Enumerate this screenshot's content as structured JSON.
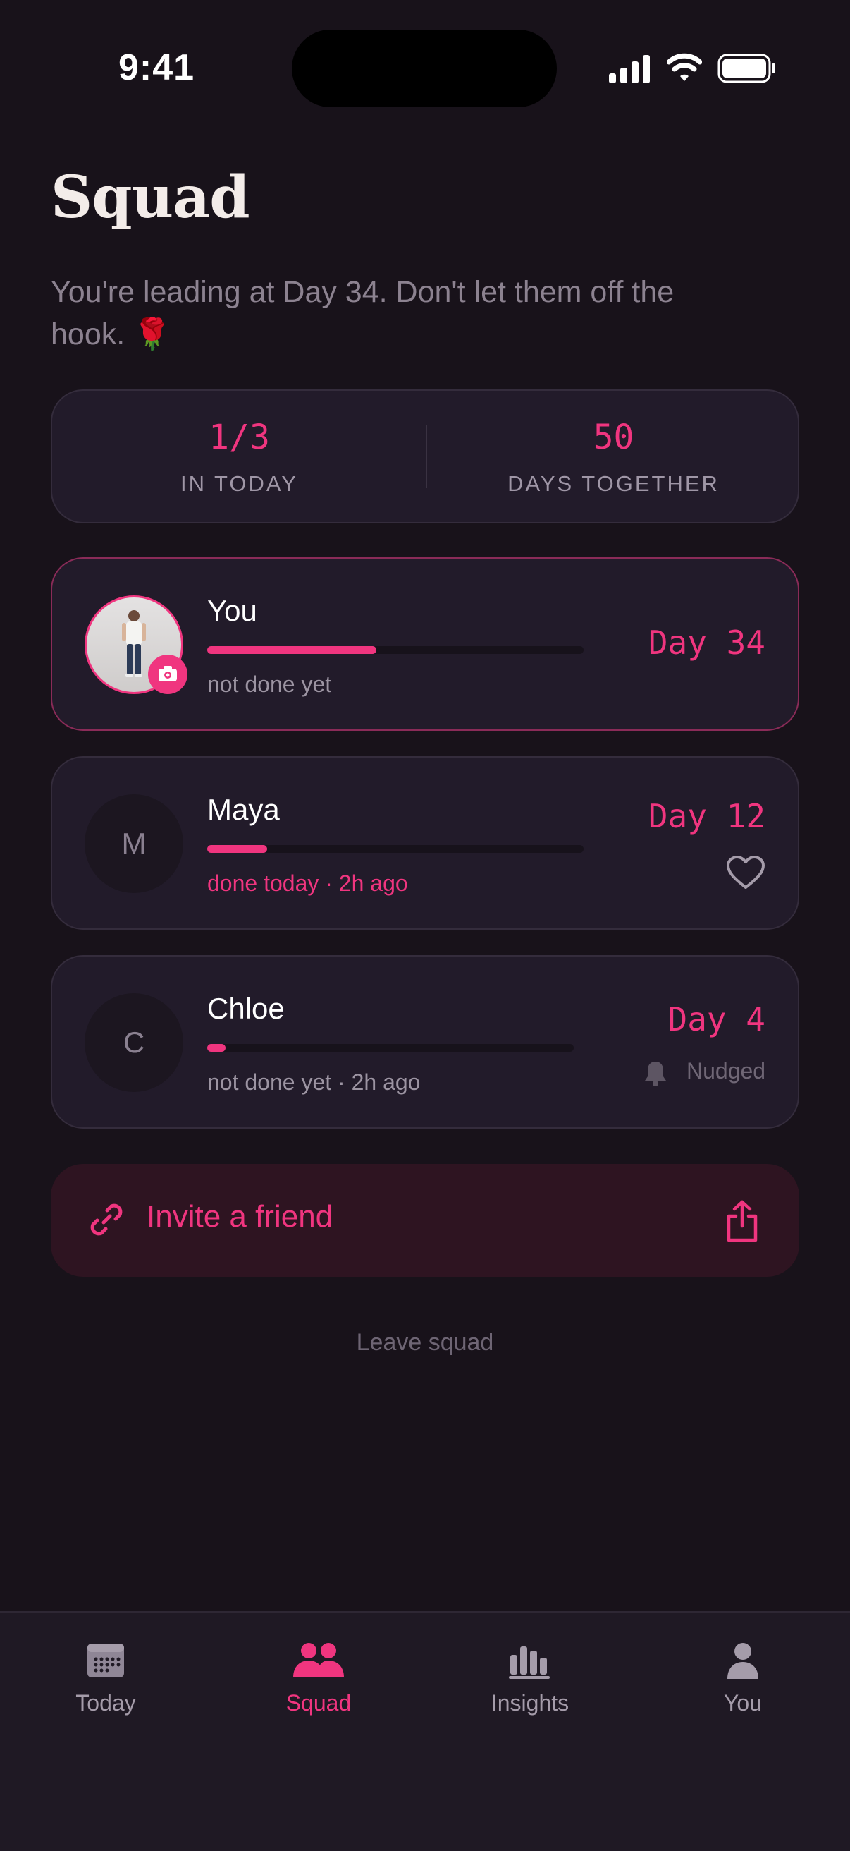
{
  "status_bar": {
    "time": "9:41"
  },
  "header": {
    "title": "Squad",
    "subtitle": "You're leading at Day 34. Don't let them off the hook. 🌹"
  },
  "stats": [
    {
      "value": "1/3",
      "label": "IN TODAY"
    },
    {
      "value": "50",
      "label": "DAYS TOGETHER"
    }
  ],
  "members": [
    {
      "name": "You",
      "initial": "",
      "status": "not done yet",
      "day": "Day 34",
      "progress": 0.45
    },
    {
      "name": "Maya",
      "initial": "M",
      "status": "done today · 2h ago",
      "day": "Day 12",
      "progress": 0.16,
      "action_icon": "heart-icon"
    },
    {
      "name": "Chloe",
      "initial": "C",
      "status": "not done yet · 2h ago",
      "day": "Day 4",
      "progress": 0.05,
      "action_label": "Nudged",
      "action_icon": "bell-icon"
    }
  ],
  "invite": {
    "label": "Invite a friend"
  },
  "leave": {
    "label": "Leave squad"
  },
  "tabs": [
    {
      "label": "Today",
      "icon": "calendar-icon",
      "active": false
    },
    {
      "label": "Squad",
      "icon": "group-icon",
      "active": true
    },
    {
      "label": "Insights",
      "icon": "bar-chart-icon",
      "active": false
    },
    {
      "label": "You",
      "icon": "person-icon",
      "active": false
    }
  ],
  "colors": {
    "accent": "#f0357f",
    "background": "#18121a",
    "card": "#221b2a"
  }
}
